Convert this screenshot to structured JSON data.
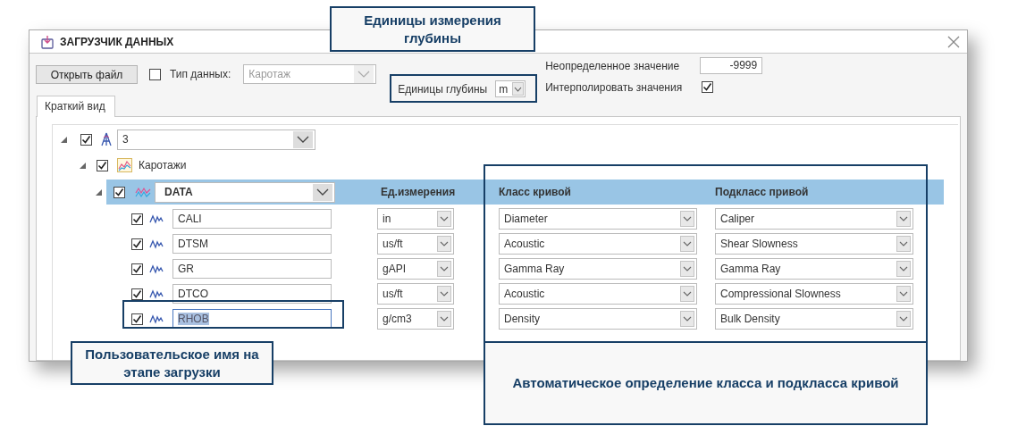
{
  "window": {
    "title": "ЗАГРУЗЧИК ДАННЫХ"
  },
  "toolbar": {
    "open_button": "Открыть файл",
    "data_type": {
      "checked": false,
      "label": "Тип данных:",
      "value": "Каротаж",
      "disabled": true
    },
    "depth_units": {
      "label": "Единицы глубины",
      "value": "m"
    },
    "undefined_value": {
      "label": "Неопределенное значение",
      "value": "-9999"
    },
    "interpolate": {
      "label": "Интерполировать значения",
      "checked": true
    }
  },
  "tabs": [
    {
      "label": "Краткий вид",
      "selected": true
    }
  ],
  "tree": {
    "value": "3",
    "expanded": true,
    "checked": true,
    "children": [
      {
        "label": "Каротажи",
        "expanded": true,
        "checked": true,
        "children": [
          {
            "value": "DATA",
            "expanded": true,
            "checked": true,
            "selected": true,
            "columns": [
              "Ед.измерения",
              "Класс кривой",
              "Подкласс привой"
            ],
            "curves": [
              {
                "checked": true,
                "name": "CALI",
                "name_selected": false,
                "unit": "in",
                "class": "Diameter",
                "subclass": "Caliper"
              },
              {
                "checked": true,
                "name": "DTSM",
                "name_selected": false,
                "unit": "us/ft",
                "class": "Acoustic",
                "subclass": "Shear Slowness"
              },
              {
                "checked": true,
                "name": "GR",
                "name_selected": false,
                "unit": "gAPI",
                "class": "Gamma Ray",
                "subclass": "Gamma Ray"
              },
              {
                "checked": true,
                "name": "DTCO",
                "name_selected": false,
                "unit": "us/ft",
                "class": "Acoustic",
                "subclass": "Compressional Slowness"
              },
              {
                "checked": true,
                "name": "RHOB",
                "name_selected": true,
                "unit": "g/cm3",
                "class": "Density",
                "subclass": "Bulk Density"
              }
            ]
          }
        ]
      }
    ]
  },
  "annotations": {
    "depth_units": "Единицы измерения глубины",
    "custom_name": "Пользовательское имя на этапе загрузки",
    "auto_class": "Автоматическое определение класса и подкласса кривой"
  }
}
